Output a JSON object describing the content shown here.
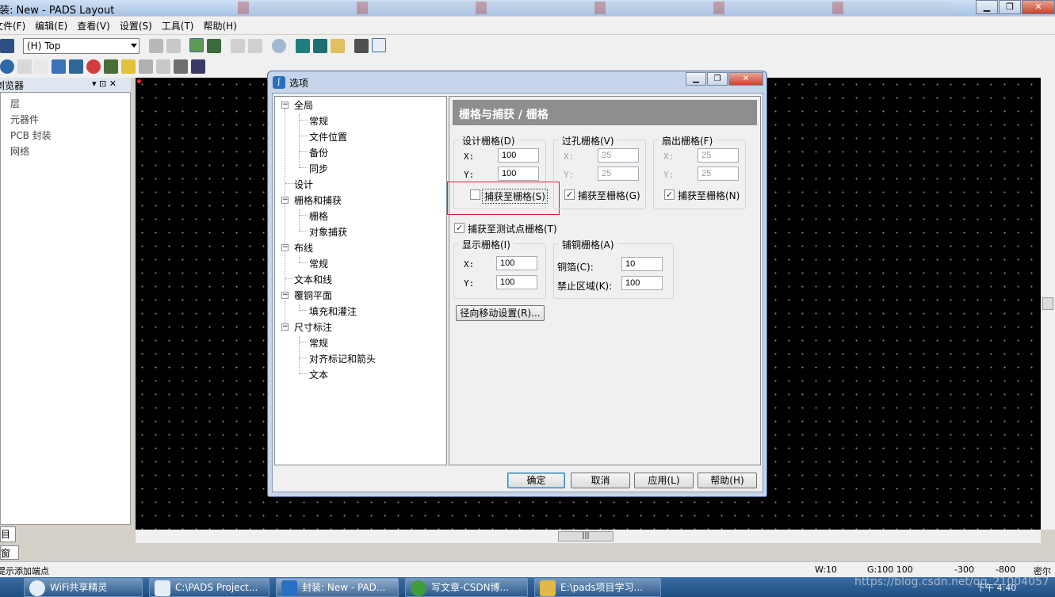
{
  "window": {
    "title": "封装: New - PADS Layout",
    "btn_min": "▁",
    "btn_max": "❐",
    "btn_close": "✕"
  },
  "menu": [
    "文件(F)",
    "编辑(E)",
    "查看(V)",
    "设置(S)",
    "工具(T)",
    "帮助(H)"
  ],
  "toolbar": {
    "layer": "(H) Top"
  },
  "side_panel": {
    "title": "浏览器",
    "pin": "▾  ⊡  ✕",
    "items": [
      "层",
      "元器件",
      "PCB 封装",
      "网络"
    ],
    "tab1": "目",
    "tab2": "窗口"
  },
  "status": {
    "hint": "提示添加端点",
    "w": "W:10",
    "g": "G:100 100",
    "x": "-300",
    "y": "-800",
    "unit": "密尔"
  },
  "taskbar": {
    "items": [
      "WiFi共享精灵",
      "C:\\PADS Project...",
      "封装: New - PAD...",
      "写文章-CSDN博...",
      "E:\\pads项目学习..."
    ],
    "clock": "下午 4:40"
  },
  "watermark": "https://blog.csdn.net/qq_21004057",
  "dialog": {
    "title": "选项",
    "icon": "ʃ",
    "tree": {
      "global": "全局",
      "global_children": [
        "常规",
        "文件位置",
        "备份",
        "同步"
      ],
      "design": "设计",
      "grid_snap": "栅格和捕获",
      "grid_snap_children": [
        "栅格",
        "对象捕获"
      ],
      "routing": "布线",
      "routing_children": [
        "常规"
      ],
      "text_lines": "文本和线",
      "copper": "覆铜平面",
      "copper_children": [
        "填充和灌注"
      ],
      "dimension": "尺寸标注",
      "dimension_children": [
        "常规",
        "对齐标记和箭头",
        "文本"
      ]
    },
    "header": "栅格与捕获 / 栅格",
    "design_grid": {
      "title": "设计栅格(D)",
      "x_label": "X:",
      "y_label": "Y:",
      "x": "100",
      "y": "100",
      "snap_label": "捕获至栅格(S)"
    },
    "via_grid": {
      "title": "过孔栅格(V)",
      "x_label": "X:",
      "y_label": "Y:",
      "x": "25",
      "y": "25",
      "snap_label": "捕获至栅格(G)"
    },
    "fanout_grid": {
      "title": "扇出栅格(F)",
      "x_label": "X:",
      "y_label": "Y:",
      "x": "25",
      "y": "25",
      "snap_label": "捕获至栅格(N)"
    },
    "snap_testpoint": "捕获至测试点栅格(T)",
    "display_grid": {
      "title": "显示栅格(I)",
      "x_label": "X:",
      "y_label": "Y:",
      "x": "100",
      "y": "100"
    },
    "pour_grid": {
      "title": "铺铜栅格(A)",
      "copper_label": "铜箔(C):",
      "keepout_label": "禁止区域(K):",
      "copper": "10",
      "keepout": "100"
    },
    "radial_button": "径向移动设置(R)...",
    "buttons": {
      "ok": "确定",
      "cancel": "取消",
      "apply": "应用(L)",
      "help": "帮助(H)"
    },
    "check_mark": "✓"
  }
}
